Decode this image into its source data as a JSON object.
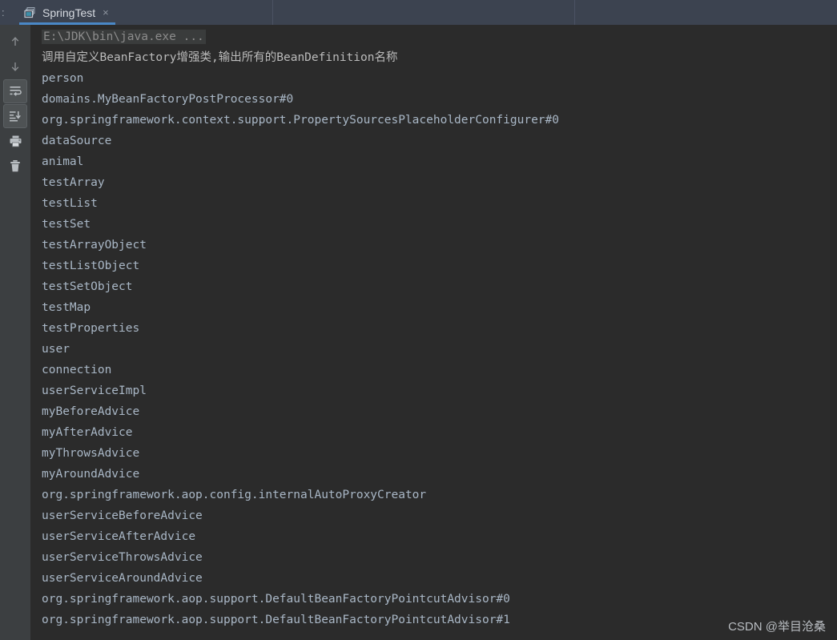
{
  "window": {
    "tabbar_prefix": ":",
    "tabs": [
      {
        "label": "SpringTest",
        "icon": "run-configuration-icon",
        "close_label": "×",
        "active": true
      }
    ],
    "separators_x": [
      340,
      717
    ],
    "accent_color": "#4a88c7",
    "tabbar_bg": "#3c4350",
    "toolbar_bg": "#3c3f41",
    "console_bg": "#2b2b2b"
  },
  "toolbar": {
    "buttons": [
      {
        "name": "up-arrow-icon",
        "title": "Up",
        "toggled": false
      },
      {
        "name": "down-arrow-icon",
        "title": "Down",
        "toggled": false
      },
      {
        "name": "soft-wrap-icon",
        "title": "Soft-Wrap",
        "toggled": true
      },
      {
        "name": "scroll-to-end-icon",
        "title": "Scroll to End",
        "toggled": true
      },
      {
        "name": "print-icon",
        "title": "Print",
        "toggled": false
      },
      {
        "name": "trash-icon",
        "title": "Clear All",
        "toggled": false
      }
    ]
  },
  "console": {
    "lines": [
      {
        "text": "E:\\JDK\\bin\\java.exe ...",
        "style": "cmdline"
      },
      {
        "text": "调用自定义BeanFactory增强类,输出所有的BeanDefinition名称",
        "style": "cjk"
      },
      {
        "text": "person",
        "style": "out"
      },
      {
        "text": "domains.MyBeanFactoryPostProcessor#0",
        "style": "out"
      },
      {
        "text": "org.springframework.context.support.PropertySourcesPlaceholderConfigurer#0",
        "style": "out"
      },
      {
        "text": "dataSource",
        "style": "out"
      },
      {
        "text": "animal",
        "style": "out"
      },
      {
        "text": "testArray",
        "style": "out"
      },
      {
        "text": "testList",
        "style": "out"
      },
      {
        "text": "testSet",
        "style": "out"
      },
      {
        "text": "testArrayObject",
        "style": "out"
      },
      {
        "text": "testListObject",
        "style": "out"
      },
      {
        "text": "testSetObject",
        "style": "out"
      },
      {
        "text": "testMap",
        "style": "out"
      },
      {
        "text": "testProperties",
        "style": "out"
      },
      {
        "text": "user",
        "style": "out"
      },
      {
        "text": "connection",
        "style": "out"
      },
      {
        "text": "userServiceImpl",
        "style": "out"
      },
      {
        "text": "myBeforeAdvice",
        "style": "out"
      },
      {
        "text": "myAfterAdvice",
        "style": "out"
      },
      {
        "text": "myThrowsAdvice",
        "style": "out"
      },
      {
        "text": "myAroundAdvice",
        "style": "out"
      },
      {
        "text": "org.springframework.aop.config.internalAutoProxyCreator",
        "style": "out"
      },
      {
        "text": "userServiceBeforeAdvice",
        "style": "out"
      },
      {
        "text": "userServiceAfterAdvice",
        "style": "out"
      },
      {
        "text": "userServiceThrowsAdvice",
        "style": "out"
      },
      {
        "text": "userServiceAroundAdvice",
        "style": "out"
      },
      {
        "text": "org.springframework.aop.support.DefaultBeanFactoryPointcutAdvisor#0",
        "style": "out"
      },
      {
        "text": "org.springframework.aop.support.DefaultBeanFactoryPointcutAdvisor#1",
        "style": "out"
      }
    ]
  },
  "watermark": {
    "text": "CSDN @举目沧桑"
  }
}
